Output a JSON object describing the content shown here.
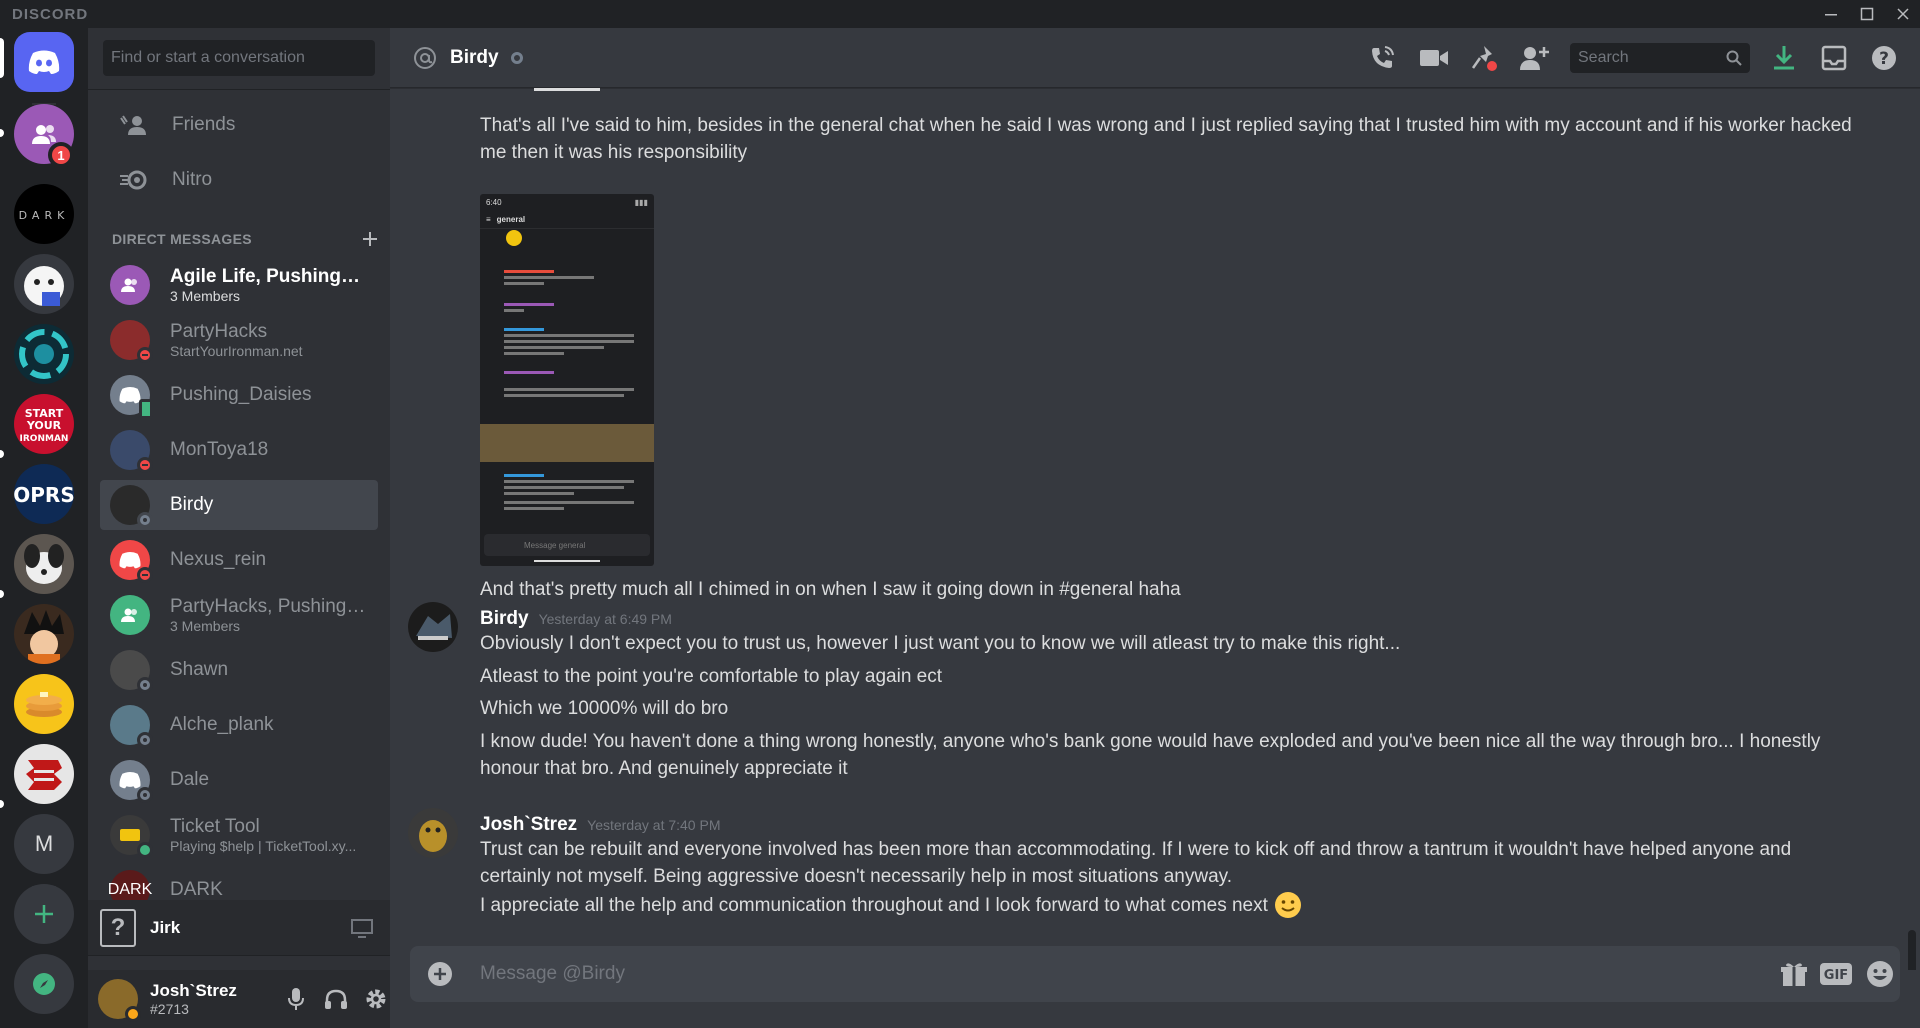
{
  "app": {
    "brand": "DISCORD"
  },
  "guild_rail": {
    "home_badge": "1",
    "guilds": [
      {
        "name": "Home",
        "icon": "discord-logo-icon"
      },
      {
        "name": "Friends guild",
        "icon": "friends-icon"
      },
      {
        "name": "DARK",
        "icon": "dark-server-icon"
      },
      {
        "name": "Mascot server",
        "icon": "mascot-icon"
      },
      {
        "name": "Swirl server",
        "icon": "swirl-icon"
      },
      {
        "name": "Start Your Ironman",
        "icon": "start-your-ironman-icon"
      },
      {
        "name": "OPRS",
        "icon": "oprs-icon"
      },
      {
        "name": "Pet server",
        "icon": "dog-icon"
      },
      {
        "name": "Anime server",
        "icon": "anime-icon"
      },
      {
        "name": "Pancake server",
        "icon": "pancake-icon"
      },
      {
        "name": "Red server",
        "icon": "red-logo-icon"
      },
      {
        "name": "M",
        "letter": "M"
      }
    ],
    "add_server_icon": "plus-icon",
    "explore_icon": "compass-icon"
  },
  "dm_sidebar": {
    "search_placeholder": "Find or start a conversation",
    "nav": [
      {
        "label": "Friends",
        "icon": "friends-wave-icon"
      },
      {
        "label": "Nitro",
        "icon": "nitro-icon"
      }
    ],
    "section_title": "DIRECT MESSAGES",
    "items": [
      {
        "name": "Agile Life, Pushing_D...",
        "sub": "3 Members",
        "color": "#9b59b6",
        "bright": true
      },
      {
        "name": "PartyHacks",
        "sub": "StartYourIronman.net",
        "color": "#8b2c2c",
        "status": "dnd"
      },
      {
        "name": "Pushing_Daisies",
        "sub": "",
        "color": "#747f8d",
        "status": "mobile"
      },
      {
        "name": "MonToya18",
        "sub": "",
        "color": "#3a4a6a",
        "status": "dnd"
      },
      {
        "name": "Birdy",
        "sub": "",
        "color": "#2a2a2a",
        "status": "offline",
        "active": true
      },
      {
        "name": "Nexus_rein",
        "sub": "",
        "color": "#f04747",
        "status": "dnd"
      },
      {
        "name": "PartyHacks, Pushing_...",
        "sub": "3 Members",
        "color": "#43b581"
      },
      {
        "name": "Shawn",
        "sub": "",
        "color": "#4a4a4a",
        "status": "offline"
      },
      {
        "name": "Alche_plank",
        "sub": "",
        "color": "#5a7a8a",
        "status": "offline"
      },
      {
        "name": "Dale",
        "sub": "",
        "color": "#747f8d",
        "status": "offline"
      },
      {
        "name": "Ticket Tool",
        "sub": "Playing $help | TicketTool.xy...",
        "color": "#3a3a3a",
        "status": "online"
      },
      {
        "name": "DARK",
        "sub": "",
        "color": "#5a1a1a"
      }
    ],
    "voice": {
      "name": "Jirk"
    },
    "user": {
      "name": "Josh`Strez",
      "tag": "#2713"
    }
  },
  "header": {
    "channel": "Birdy",
    "search_placeholder": "Search"
  },
  "messages": {
    "pre": [
      "That's all I've said to him, besides in the general chat when he said I was wrong and I just replied saying that I trusted him with my account and if his worker hacked me then it was his responsibility",
      "And that's pretty much all I chimed in on when I saw it going down in #general haha"
    ],
    "attachment": {
      "time": "6:40",
      "channel": "general",
      "composer": "Message general"
    },
    "groups": [
      {
        "author": "Birdy",
        "timestamp": "Yesterday at 6:49 PM",
        "lines": [
          "Obviously I don't expect you to trust us, however I just want you to know we will atleast try to make this right...",
          "Atleast to the point you're comfortable to play again ect",
          "Which we 10000% will do bro",
          "I know dude! You haven't done a thing wrong honestly, anyone who's bank gone would have exploded and you've been nice all the way through bro... I honestly honour that bro. And genuinely appreciate it"
        ]
      },
      {
        "author": "Josh`Strez",
        "timestamp": "Yesterday at 7:40 PM",
        "lines": [
          "Trust can be rebuilt and everyone involved has been more than accommodating. If I were to kick off and throw a tantrum it wouldn't have helped anyone and certainly not myself. Being aggressive doesn't necessarily help in most situations anyway.",
          "I appreciate all the help and communication throughout and I look forward to what comes next"
        ]
      }
    ]
  },
  "composer": {
    "placeholder": "Message @Birdy"
  },
  "colors": {
    "blurple": "#5865f2",
    "online": "#43b581",
    "dnd": "#f04747",
    "offline": "#747f8d",
    "download": "#43b581"
  }
}
